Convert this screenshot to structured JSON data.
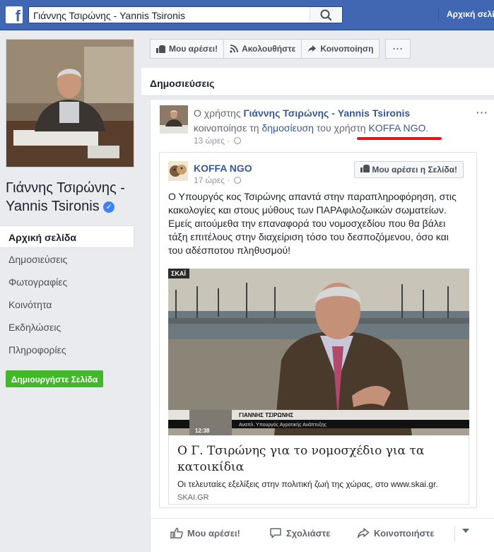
{
  "topbar": {
    "logo": "f",
    "search_value": "Γιάννης Τσιρώνης - Yannis Tsironis",
    "home_label": "Αρχική σελί"
  },
  "sidebar": {
    "page_name": "Γιάννης Τσιρώνης - Yannis Tsironis",
    "verified_mark": "✓",
    "items": [
      {
        "label": "Αρχική σελίδα",
        "active": true
      },
      {
        "label": "Δημοσιεύσεις"
      },
      {
        "label": "Φωτογραφίες"
      },
      {
        "label": "Κοινότητα"
      },
      {
        "label": "Εκδηλώσεις"
      },
      {
        "label": "Πληροφορίες"
      }
    ],
    "create_page_label": "Δημιουργήστε Σελίδα"
  },
  "actionbar": {
    "like_label": "Μου αρέσει!",
    "follow_label": "Ακολουθήστε",
    "share_label": "Κοινοποίηση",
    "more_label": "···"
  },
  "posts": {
    "title": "Δημοσιεύσεις"
  },
  "post": {
    "line1_prefix": "Ο χρήστης",
    "author": "Γιάννης Τσιρώνης - Yannis Tsironis",
    "line2_prefix": "κοινοποίησε τη",
    "post_word": "δημοσίευση",
    "line2_mid": "του χρήστη",
    "shared_user": "KOFFA NGO",
    "line2_end": ".",
    "time": "13 ώρες ·",
    "options": "···",
    "shared": {
      "name": "KOFFA NGO",
      "time": "17 ώρες ·",
      "like_page_label": "Μου αρέσει η Σελίδα!",
      "text": "Ο Υπουργός κος Τσιρώνης απαντά στην παραπληροφόρηση, στις κακολογίες και στους μύθους των ΠΑΡΑφιλοζωικών σωματείων. Εμείς αιτούμεθα την επαναφορά του νομοσχεδίου που θα βάλει τάξη επιτέλους στην διαχείριση τόσο του δεσποζόμενου, όσο και του αδέσποτου πληθυσμού!",
      "video": {
        "channel": "ΣΚΑΪ",
        "caption_name": "ΓΙΑΝΝΗΣ ΤΣΙΡΩΝΗΣ",
        "caption_role": "Αναπλ. Υπουργός Αγροτικής Ανάπτυξης",
        "clock": "12:38"
      },
      "link_title": "Ο Γ. Τσιρώνης για το νομοσχέδιο για τα κατοικίδια",
      "link_desc": "Οι τελευταίες εξελίξεις στην πολιτική ζωή της χώρας, στο www.skai.gr.",
      "link_domain": "SKAI.GR"
    },
    "actions": {
      "like": "Μου αρέσει!",
      "comment": "Σχολιάστε",
      "share": "Κοινοποιήστε"
    }
  },
  "colors": {
    "brand": "#4267b2",
    "link": "#385898",
    "highlight_underline": "#e8101a",
    "create_button": "#42b72a"
  }
}
